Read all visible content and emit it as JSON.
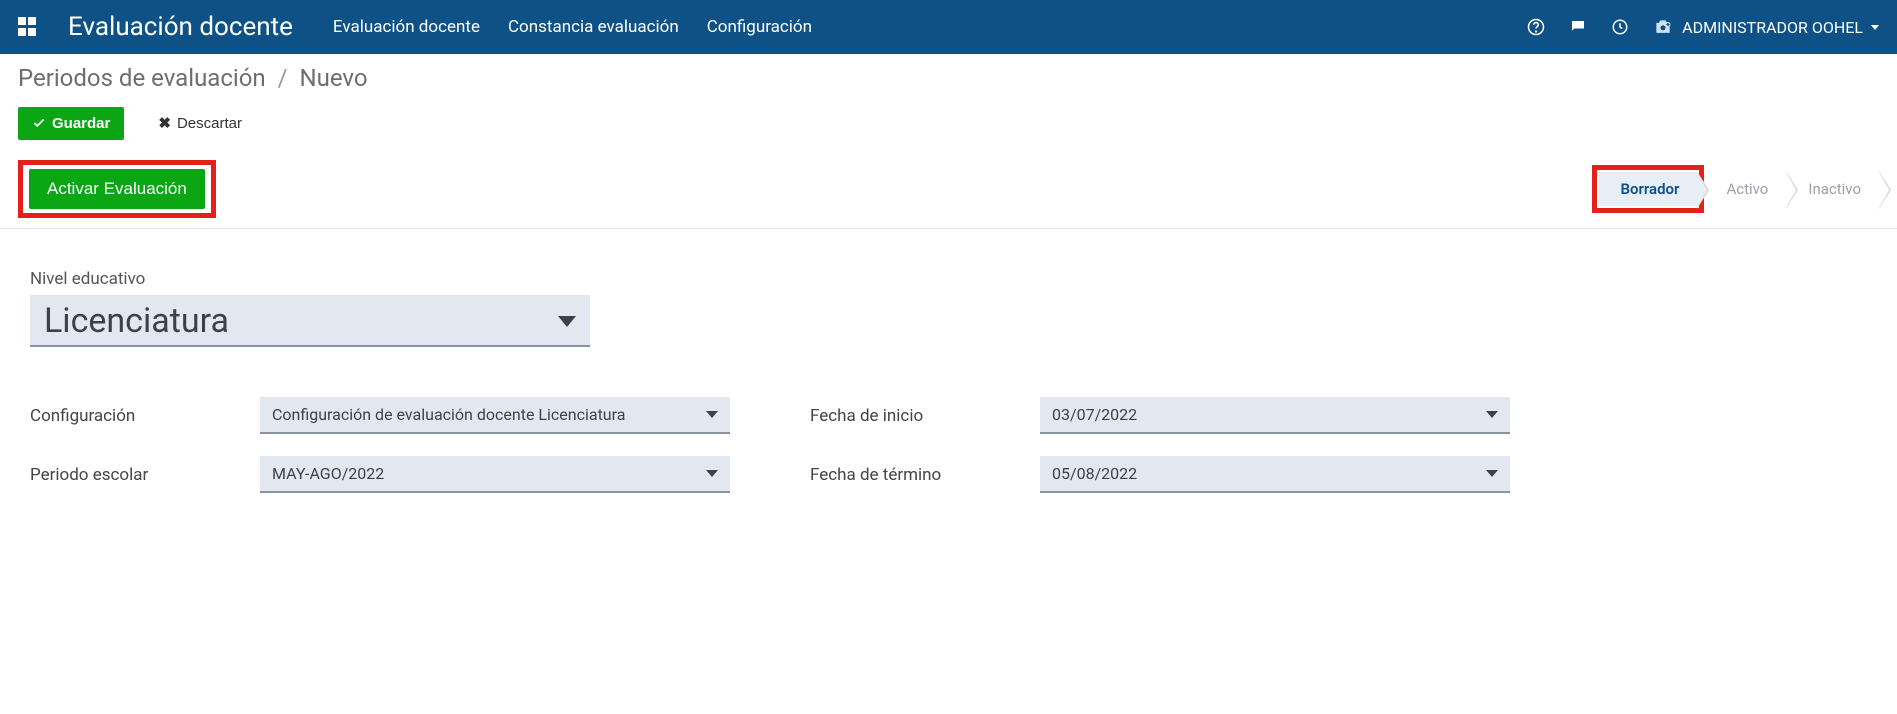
{
  "navbar": {
    "brand": "Evaluación docente",
    "menu": [
      "Evaluación docente",
      "Constancia evaluación",
      "Configuración"
    ],
    "user": "ADMINISTRADOR OOHEL"
  },
  "breadcrumb": {
    "root": "Periodos de evaluación",
    "current": "Nuevo"
  },
  "buttons": {
    "save": "Guardar",
    "discard": "Descartar",
    "activate": "Activar Evaluación"
  },
  "status": {
    "steps": [
      "Borrador",
      "Activo",
      "Inactivo"
    ],
    "active_index": 0
  },
  "form": {
    "nivel_label": "Nivel educativo",
    "nivel_value": "Licenciatura",
    "config_label": "Configuración",
    "config_value": "Configuración de evaluación docente Licenciatura",
    "periodo_label": "Periodo escolar",
    "periodo_value": "MAY-AGO/2022",
    "inicio_label": "Fecha de inicio",
    "inicio_value": "03/07/2022",
    "termino_label": "Fecha de término",
    "termino_value": "05/08/2022"
  }
}
